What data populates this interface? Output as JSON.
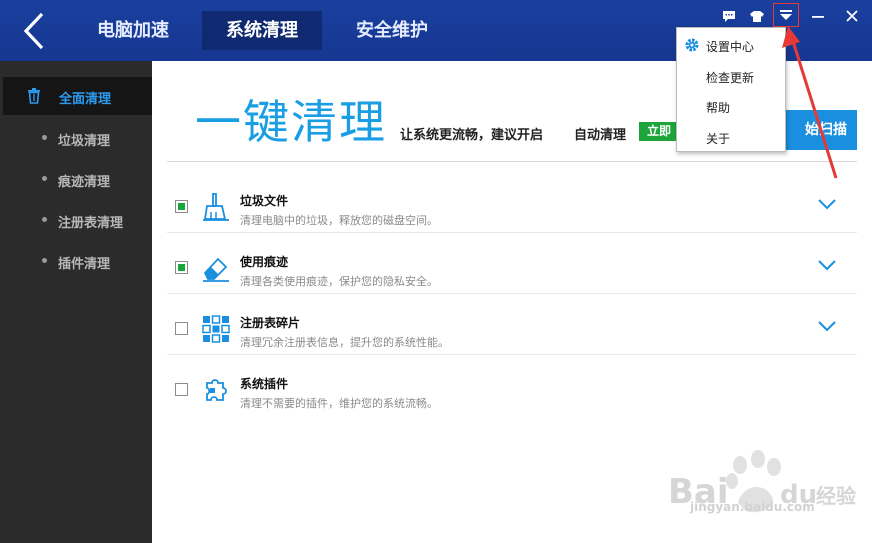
{
  "nav": {
    "back_icon": "chevron-left-icon",
    "tabs": [
      {
        "label": "电脑加速",
        "active": false
      },
      {
        "label": "系统清理",
        "active": true
      },
      {
        "label": "安全维护",
        "active": false
      }
    ],
    "controls": [
      "feedback-icon",
      "skin-shirt-icon",
      "menu-dropdown-icon",
      "minimize-icon",
      "close-icon"
    ]
  },
  "sidebar": {
    "main": {
      "label": "全面清理",
      "icon": "trash-icon"
    },
    "items": [
      {
        "label": "垃圾清理"
      },
      {
        "label": "痕迹清理"
      },
      {
        "label": "注册表清理"
      },
      {
        "label": "插件清理"
      }
    ]
  },
  "hero": {
    "title": "一键清理",
    "subtitle": "让系统更流畅，建议开启",
    "auto_label": "自动清理",
    "auto_button": "立即",
    "scan_button": "始扫描"
  },
  "rows": [
    {
      "title": "垃圾文件",
      "desc": "清理电脑中的垃圾，释放您的磁盘空间。",
      "checked": true,
      "icon": "broom-icon"
    },
    {
      "title": "使用痕迹",
      "desc": "清理各类使用痕迹，保护您的隐私安全。",
      "checked": true,
      "icon": "eraser-icon"
    },
    {
      "title": "注册表碎片",
      "desc": "清理冗余注册表信息，提升您的系统性能。",
      "checked": false,
      "icon": "registry-grid-icon"
    },
    {
      "title": "系统插件",
      "desc": "清理不需要的插件，维护您的系统流畅。",
      "checked": false,
      "icon": "puzzle-plugin-icon"
    }
  ],
  "menu": {
    "items": [
      {
        "label": "设置中心",
        "icon": "gear-icon"
      },
      {
        "label": "检查更新"
      },
      {
        "label": "帮助"
      },
      {
        "label": "关于"
      }
    ]
  },
  "watermark": {
    "logo": "Baidu经验",
    "url": "jingyan.baidu.com"
  },
  "colors": {
    "nav_bg": "#1a3f9e",
    "accent_blue": "#1a9ee3",
    "green": "#1ea53a",
    "sidebar_bg": "#2b2b2b",
    "annotation_red": "#e53935"
  }
}
